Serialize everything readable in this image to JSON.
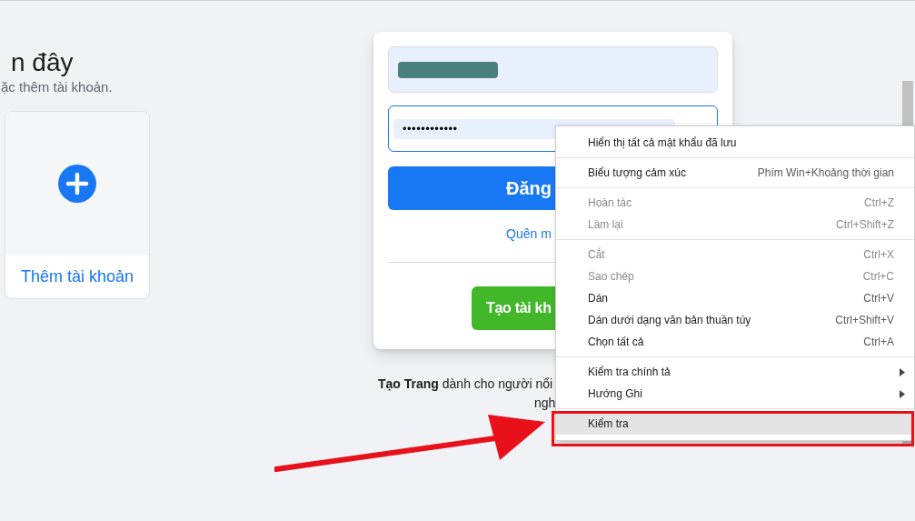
{
  "left_panel": {
    "heading": "n đây",
    "subtitle": "ặc thêm tài khoản.",
    "add_account": {
      "label": "Thêm tài khoản"
    }
  },
  "login_card": {
    "password": {
      "value": "••••••••••••"
    },
    "login_button": "Đăng",
    "forgot_link": "Quên m",
    "create_button": "Tạo tài kh"
  },
  "footer": {
    "line_1": "**Tạo Trang** dành cho người nổi",
    "line_2": "ngh"
  },
  "context_menu": {
    "groups": [
      [
        {
          "label": "Hiển thị tất cả mật khẩu đã lưu",
          "disabled": false,
          "submenu": false,
          "selected": false
        }
      ],
      [
        {
          "label": "Biểu tượng cảm xúc",
          "shortcut": "Phím Win+Khoảng thời gian",
          "disabled": false,
          "submenu": false,
          "selected": false
        }
      ],
      [
        {
          "label": "Hoàn tác",
          "shortcut": "Ctrl+Z",
          "disabled": true,
          "submenu": false,
          "selected": false
        },
        {
          "label": "Làm lại",
          "shortcut": "Ctrl+Shift+Z",
          "disabled": true,
          "submenu": false,
          "selected": false
        }
      ],
      [
        {
          "label": "Cắt",
          "shortcut": "Ctrl+X",
          "disabled": true,
          "submenu": false,
          "selected": false
        },
        {
          "label": "Sao chép",
          "shortcut": "Ctrl+C",
          "disabled": true,
          "submenu": false,
          "selected": false
        },
        {
          "label": "Dán",
          "shortcut": "Ctrl+V",
          "disabled": false,
          "submenu": false,
          "selected": false
        },
        {
          "label": "Dán dưới dạng văn bản thuần túy",
          "shortcut": "Ctrl+Shift+V",
          "disabled": false,
          "submenu": false,
          "selected": false
        },
        {
          "label": "Chọn tất cả",
          "shortcut": "Ctrl+A",
          "disabled": false,
          "submenu": false,
          "selected": false
        }
      ],
      [
        {
          "label": "Kiểm tra chính tả",
          "disabled": false,
          "submenu": true,
          "selected": false
        },
        {
          "label": "Hướng Ghi",
          "disabled": false,
          "submenu": true,
          "selected": false
        }
      ],
      [
        {
          "label": "Kiểm tra",
          "disabled": false,
          "submenu": false,
          "selected": true
        }
      ]
    ]
  }
}
